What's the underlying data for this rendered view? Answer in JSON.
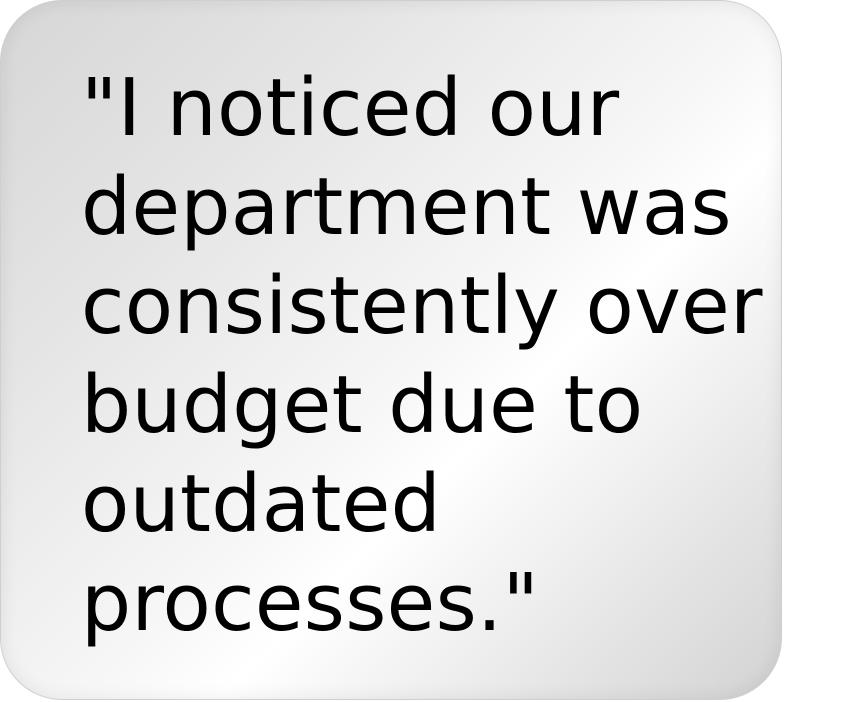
{
  "quote": {
    "text": "\"I noticed our\ndepartment was\nconsistently over\nbudget due to\noutdated\nprocesses.\""
  },
  "colors": {
    "text": "#000000",
    "card_light": "#ffffff",
    "card_dark": "#d2d2d2",
    "background": "#ffffff"
  }
}
